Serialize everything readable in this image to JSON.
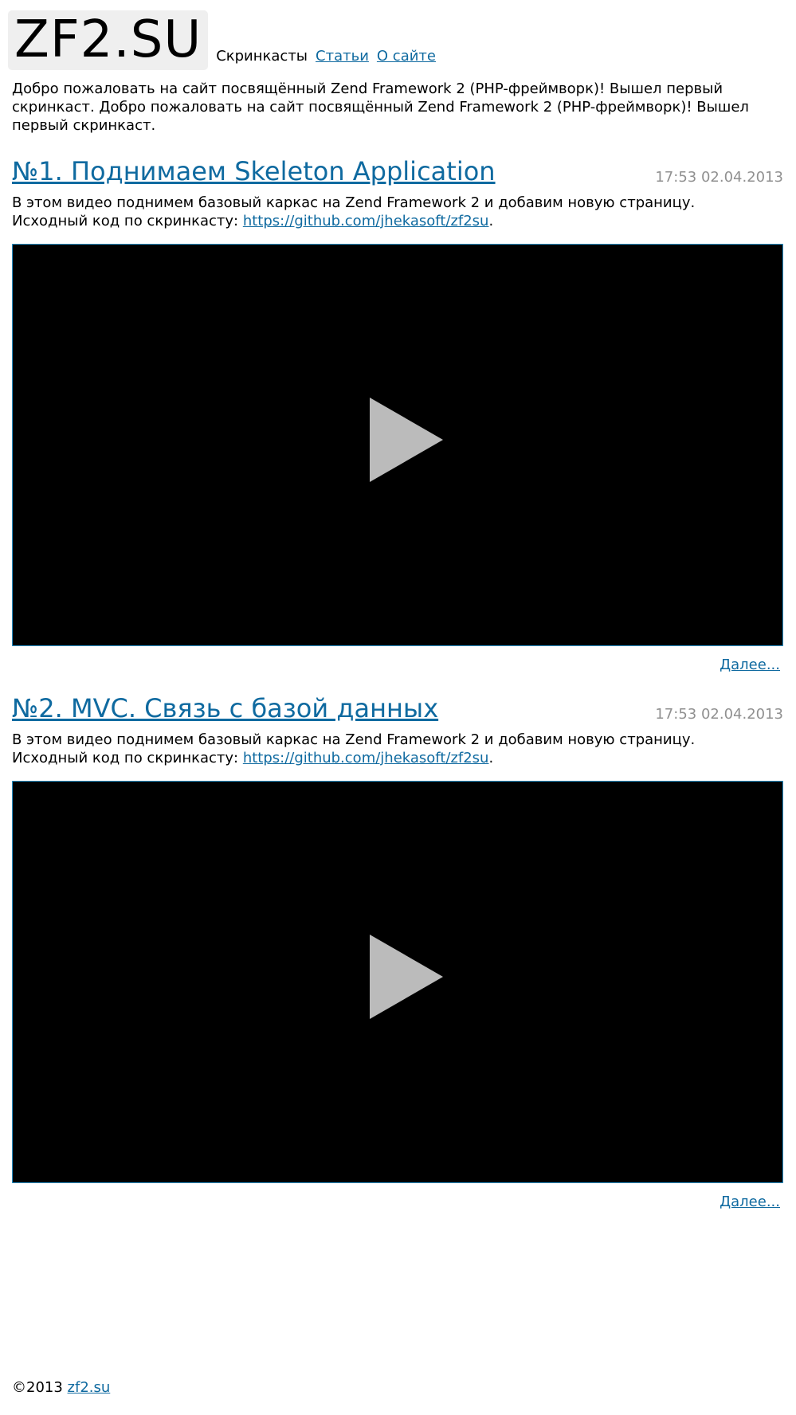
{
  "header": {
    "logo": "ZF2.SU",
    "nav": [
      {
        "label": "Скринкасты",
        "active": true
      },
      {
        "label": "Статьи",
        "active": false
      },
      {
        "label": "О сайте",
        "active": false
      }
    ]
  },
  "intro": "Добро пожаловать на сайт посвящённый Zend Framework 2 (PHP-фреймворк)! Вышел первый скринкаст. Добро пожаловать на сайт посвящённый Zend Framework 2 (PHP-фреймворк)! Вышел первый скринкаст.",
  "articles": [
    {
      "title": "№1. Поднимаем Skeleton Application",
      "date": "17:53 02.04.2013",
      "desc_line1": "В этом видео поднимем базовый каркас на Zend Framework 2 и добавим новую страницу.",
      "desc_prefix": "Исходный код по скринкасту: ",
      "link": "https://github.com/jhekasoft/zf2su",
      "desc_suffix": ".",
      "more": "Далее..."
    },
    {
      "title": "№2. MVC. Связь с базой данных",
      "date": "17:53 02.04.2013",
      "desc_line1": "В этом видео поднимем базовый каркас на Zend Framework 2 и добавим новую страницу.",
      "desc_prefix": "Исходный код по скринкасту: ",
      "link": "https://github.com/jhekasoft/zf2su",
      "desc_suffix": ".",
      "more": "Далее..."
    }
  ],
  "footer": {
    "copyright": "©2013 ",
    "link": "zf2.su"
  },
  "colors": {
    "link": "#0f6aa0",
    "date": "#909090",
    "logo_bg": "#efefef",
    "video_bg": "#000000",
    "video_border": "#2a8fc4",
    "play": "#bbbbbb"
  },
  "icons": [
    "play-icon"
  ]
}
